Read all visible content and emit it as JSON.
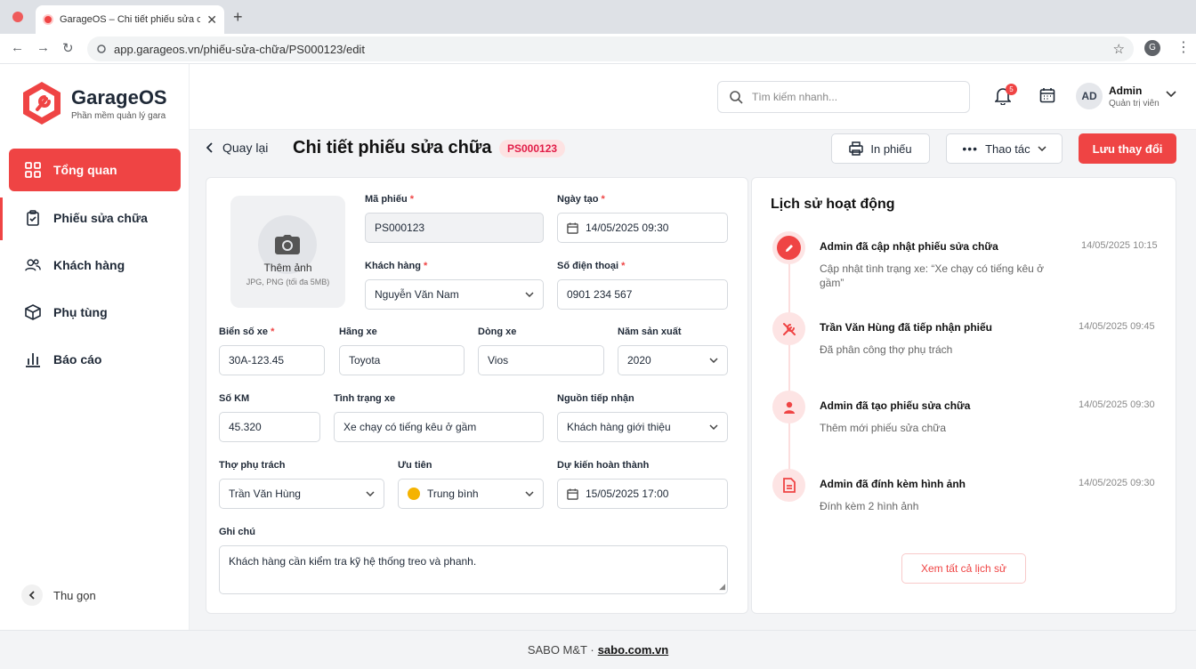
{
  "browser": {
    "tab_title": "GarageOS – Chi tiết phiếu sửa chữa",
    "url": "app.garageos.vn/phiếu-sửa-chữa/PS000123/edit",
    "profile_initial": "G"
  },
  "brand": {
    "name": "GarageOS",
    "tagline": "Phần mềm quản lý gara",
    "accent": "#ef4444"
  },
  "sidebar": {
    "items": [
      {
        "label": "Tổng quan",
        "icon": "dashboard-icon"
      },
      {
        "label": "Phiếu sửa chữa",
        "icon": "clipboard-icon"
      },
      {
        "label": "Khách hàng",
        "icon": "users-icon"
      },
      {
        "label": "Phụ tùng",
        "icon": "box-icon"
      },
      {
        "label": "Báo cáo",
        "icon": "bar-chart-icon"
      }
    ],
    "collapse_label": "Thu gọn"
  },
  "topbar": {
    "search_placeholder": "Tìm kiếm nhanh...",
    "notification_count": "5",
    "avatar_initials": "AD",
    "user_name": "Admin",
    "user_role": "Quản trị viên"
  },
  "header": {
    "back_label": "Quay lại",
    "title": "Chi tiết phiếu sửa chữa",
    "code": "PS000123",
    "print_label": "In phiếu",
    "actions_label": "Thao tác",
    "save_label": "Lưu thay đổi"
  },
  "form": {
    "upload_title": "Thêm ảnh",
    "upload_hint": "JPG, PNG (tối đa 5MB)",
    "ticket_code_label": "Mã phiếu",
    "ticket_code": "PS000123",
    "created_label": "Ngày tạo",
    "created": "14/05/2025 09:30",
    "customer_label": "Khách hàng",
    "customer": "Nguyễn Văn Nam",
    "phone_label": "Số điện thoại",
    "phone": "0901 234 567",
    "plate_label": "Biển số xe",
    "plate": "30A-123.45",
    "brand_label": "Hãng xe",
    "brand": "Toyota",
    "model_label": "Dòng xe",
    "model": "Vios",
    "year_label": "Năm sản xuất",
    "year": "2020",
    "km_label": "Số KM",
    "km": "45.320",
    "condition_label": "Tình trạng xe",
    "condition": "Xe chạy có tiếng kêu ở gầm",
    "source_label": "Nguồn tiếp nhận",
    "source": "Khách hàng giới thiệu",
    "tech_label": "Thợ phụ trách",
    "tech": "Trần Văn Hùng",
    "priority_label": "Ưu tiên",
    "priority": "Trung bình",
    "priority_color": "#f5b301",
    "eta_label": "Dự kiến hoàn thành",
    "eta": "15/05/2025 17:00",
    "notes_label": "Ghi chú",
    "notes": "Khách hàng cần kiểm tra kỹ hệ thống treo và phanh."
  },
  "history": {
    "title": "Lịch sử hoạt động",
    "items": [
      {
        "title": "Admin đã cập nhật phiếu sửa chữa",
        "desc": "Cập nhật tình trạng xe: “Xe chạy có tiếng kêu ở gầm”",
        "time": "14/05/2025 10:15",
        "icon": "pencil-icon"
      },
      {
        "title": "Trần Văn Hùng đã tiếp nhận phiếu",
        "desc": "Đã phân công thợ phụ trách",
        "time": "14/05/2025 09:45",
        "icon": "wrench-icon"
      },
      {
        "title": "Admin đã tạo phiếu sửa chữa",
        "desc": "Thêm mới phiếu sửa chữa",
        "time": "14/05/2025 09:30",
        "icon": "user-icon"
      },
      {
        "title": "Admin đã đính kèm hình ảnh",
        "desc": "Đính kèm 2 hình ảnh",
        "time": "14/05/2025 09:30",
        "icon": "document-icon"
      }
    ],
    "view_all_label": "Xem tất cả lịch sử"
  },
  "footer": {
    "company": "SABO M&T ·",
    "link": "sabo.com.vn"
  }
}
